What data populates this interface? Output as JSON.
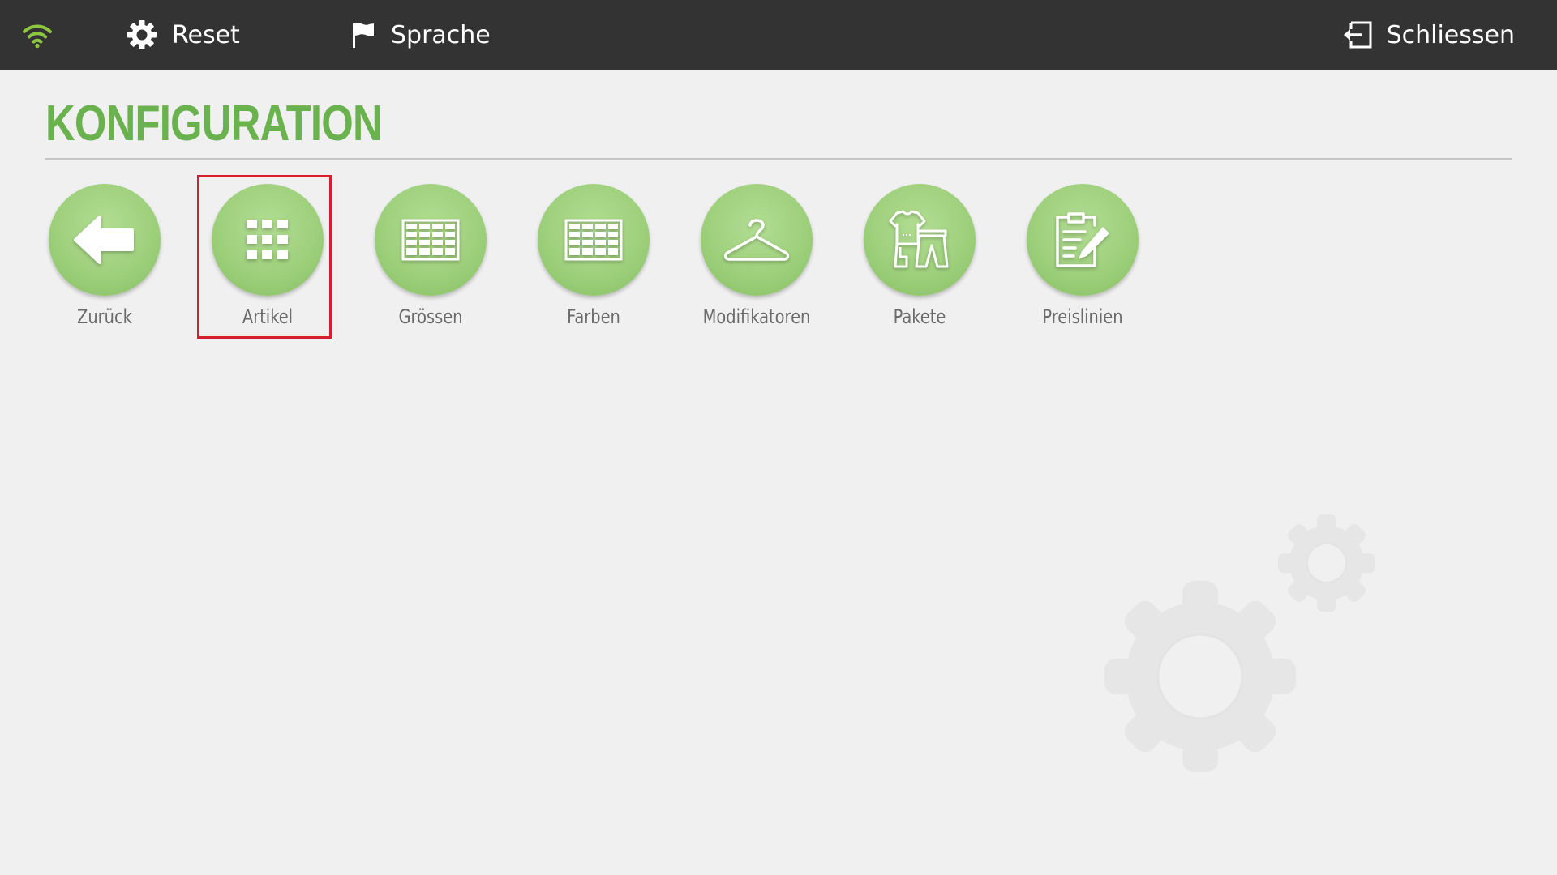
{
  "topbar": {
    "wifi_icon": "wifi-icon",
    "reset": {
      "icon": "gear-icon",
      "label": "Reset"
    },
    "language": {
      "icon": "flag-icon",
      "label": "Sprache"
    },
    "close": {
      "icon": "exit-icon",
      "label": "Schliessen"
    },
    "colors": {
      "background": "#333333",
      "wifi": "#8dc63f",
      "text": "#ffffff"
    }
  },
  "page": {
    "title": "KONFIGURATION",
    "title_color": "#6ab24d"
  },
  "tiles": [
    {
      "label": "Zurück",
      "icon": "back-arrow-icon",
      "selected": false
    },
    {
      "label": "Artikel",
      "icon": "grid-icon",
      "selected": true
    },
    {
      "label": "Grössen",
      "icon": "table-icon",
      "selected": false
    },
    {
      "label": "Farben",
      "icon": "table-icon",
      "selected": false
    },
    {
      "label": "Modifikatoren",
      "icon": "hanger-icon",
      "selected": false
    },
    {
      "label": "Pakete",
      "icon": "clothing-set-icon",
      "selected": false
    },
    {
      "label": "Preislinien",
      "icon": "clipboard-edit-icon",
      "selected": false
    }
  ],
  "colors": {
    "tile_circle": "#9ed07c",
    "selection_border": "#d4202a",
    "background": "#f0f0f0"
  }
}
